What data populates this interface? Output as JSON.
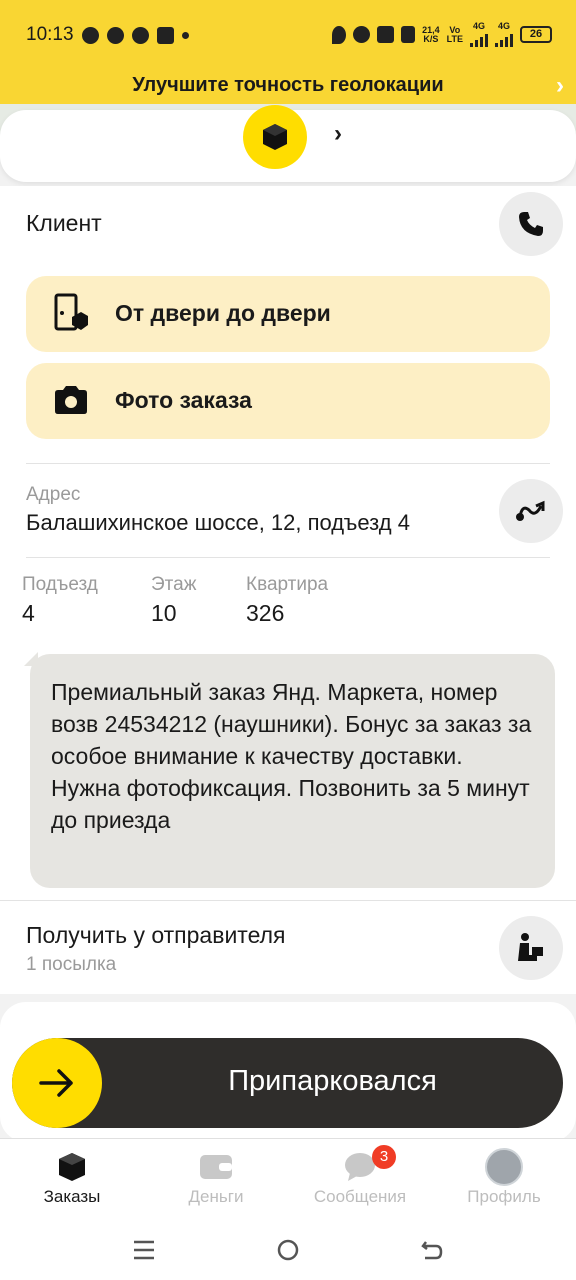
{
  "status_bar": {
    "time": "10:13",
    "speed": "21,4",
    "speed_unit": "K/S",
    "net1": "Vo",
    "net1b": "LTE",
    "net2": "4G",
    "net3": "4G",
    "battery": "26"
  },
  "geo_banner": {
    "text": "Улучшите точность геолокации"
  },
  "order": {
    "client_label": "Клиент",
    "actions": [
      {
        "label": "От двери до двери",
        "icon": "door-box-icon"
      },
      {
        "label": "Фото заказа",
        "icon": "camera-icon"
      }
    ],
    "address_label": "Адрес",
    "address_value": "Балашихинское шоссе, 12, подъезд 4",
    "entrance_label": "Подъезд",
    "entrance_value": "4",
    "floor_label": "Этаж",
    "floor_value": "10",
    "apartment_label": "Квартира",
    "apartment_value": "326",
    "comment": "Премиальный заказ Янд. Маркета, номер возв 24534212 (наушники). Бонус за заказ за особое внимание к качеству доставки. Нужна фотофиксация. Позвонить за 5 минут до приезда",
    "pickup_title": "Получить у отправителя",
    "pickup_subtitle": "1 посылка"
  },
  "park_button": {
    "label": "Припарковался"
  },
  "tabs": [
    {
      "label": "Заказы",
      "active": true
    },
    {
      "label": "Деньги",
      "active": false
    },
    {
      "label": "Сообщения",
      "active": false,
      "badge": "3"
    },
    {
      "label": "Профиль",
      "active": false
    }
  ],
  "colors": {
    "accent": "#ffdd00",
    "status_bar": "#f9d633",
    "action_bg": "#fdefc5",
    "park_bg": "#2f2d2b",
    "badge": "#f03c25"
  }
}
